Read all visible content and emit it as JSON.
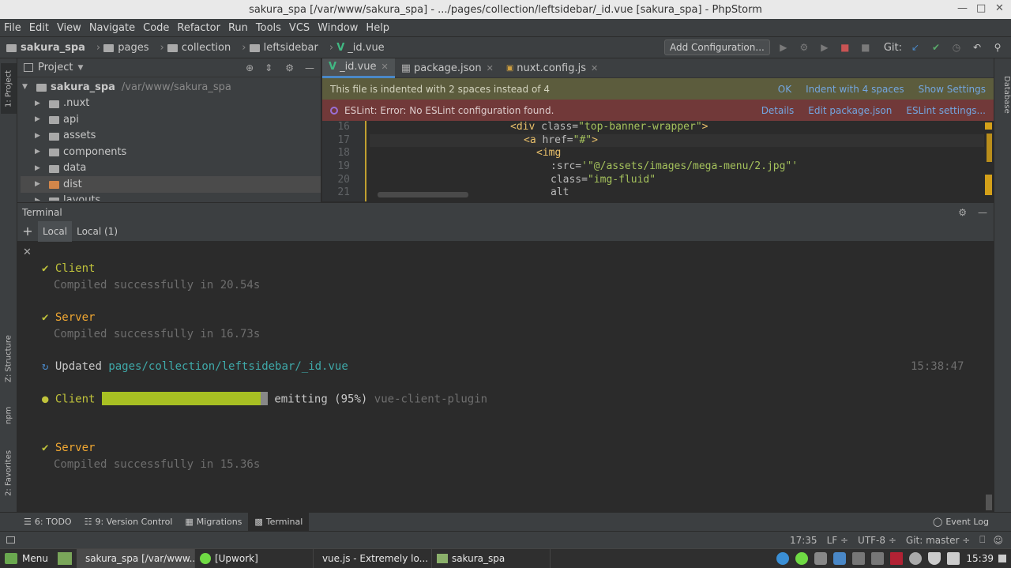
{
  "window": {
    "title": "sakura_spa [/var/www/sakura_spa] - .../pages/collection/leftsidebar/_id.vue [sakura_spa] - PhpStorm"
  },
  "menu": [
    "File",
    "Edit",
    "View",
    "Navigate",
    "Code",
    "Refactor",
    "Run",
    "Tools",
    "VCS",
    "Window",
    "Help"
  ],
  "breadcrumbs": [
    "sakura_spa",
    "pages",
    "collection",
    "leftsidebar",
    "_id.vue"
  ],
  "toolbar": {
    "add_config": "Add Configuration...",
    "git_label": "Git:"
  },
  "stripes": {
    "project": "1: Project",
    "structure": "Z: Structure",
    "npm": "npm",
    "favorites": "2: Favorites",
    "database": "Database"
  },
  "project": {
    "header": "Project",
    "root": {
      "name": "sakura_spa",
      "path": "/var/www/sakura_spa"
    },
    "items": [
      ".nuxt",
      "api",
      "assets",
      "components",
      "data",
      "dist",
      "layouts"
    ]
  },
  "editor": {
    "tabs": [
      "_id.vue",
      "package.json",
      "nuxt.config.js"
    ],
    "indent_banner": {
      "text": "This file is indented with 2 spaces instead of 4",
      "actions": [
        "OK",
        "Indent with 4 spaces",
        "Show Settings"
      ]
    },
    "eslint_banner": {
      "text": "ESLint: Error: No ESLint configuration found.",
      "actions": [
        "Details",
        "Edit package.json",
        "ESLint settings..."
      ]
    },
    "line_numbers": [
      "16",
      "17",
      "18",
      "19",
      "20",
      "21"
    ],
    "code": {
      "l16_tag": "<div",
      "l16_attr": " class=",
      "l16_val": "\"top-banner-wrapper\"",
      "l16_end": ">",
      "l17_tag": "<a",
      "l17_attr": " href=",
      "l17_val": "\"#\"",
      "l17_end": ">",
      "l18_tag": "<img",
      "l19_attr": ":src=",
      "l19_val": "'\"@/assets/images/mega-menu/2.jpg\"'",
      "l20_attr": "class=",
      "l20_val": "\"img-fluid\"",
      "l21_attr": "alt"
    }
  },
  "terminal": {
    "title": "Terminal",
    "tabs": [
      "Local",
      "Local (1)"
    ],
    "lines": {
      "client_label": "Client",
      "client_msg": "Compiled successfully in 20.54s",
      "server_label": "Server",
      "server_msg": "Compiled successfully in 16.73s",
      "updated_label": "Updated",
      "updated_path": "pages/collection/leftsidebar/_id.vue",
      "updated_time": "15:38:47",
      "client2_label": "Client",
      "client2_status": "emitting (95%)",
      "client2_plugin": "vue-client-plugin",
      "server2_label": "Server",
      "server2_msg": "Compiled successfully in 15.36s"
    },
    "progress": 0.95
  },
  "bottom_tabs": [
    "6: TODO",
    "9: Version Control",
    "Migrations",
    "Terminal"
  ],
  "event_log": "Event Log",
  "status": {
    "position": "17:35",
    "line_sep": "LF ÷",
    "encoding": "UTF-8 ÷",
    "git": "Git: master ÷"
  },
  "taskbar": {
    "menu": "Menu",
    "tasks": [
      "sakura_spa [/var/www...",
      "[Upwork]",
      "vue.js - Extremely lo...",
      "sakura_spa"
    ],
    "clock": "15:39"
  }
}
